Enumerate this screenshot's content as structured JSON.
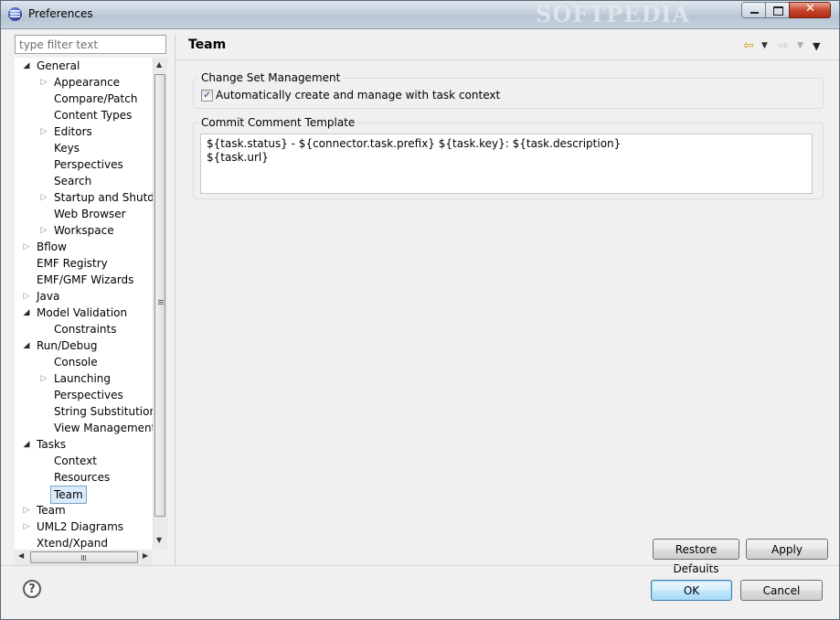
{
  "window": {
    "title": "Preferences",
    "watermark": "SOFTPEDIA",
    "minimize": "minimize",
    "maximize": "maximize",
    "close": "close"
  },
  "filter": {
    "placeholder": "type filter text"
  },
  "tree": [
    {
      "label": "General",
      "level": 0,
      "twisty": "open",
      "icon": "tree-twisty-open-icon"
    },
    {
      "label": "Appearance",
      "level": 1,
      "twisty": "closed",
      "icon": "tree-twisty-closed-icon"
    },
    {
      "label": "Compare/Patch",
      "level": 1,
      "twisty": "none"
    },
    {
      "label": "Content Types",
      "level": 1,
      "twisty": "none"
    },
    {
      "label": "Editors",
      "level": 1,
      "twisty": "closed",
      "icon": "tree-twisty-closed-icon"
    },
    {
      "label": "Keys",
      "level": 1,
      "twisty": "none"
    },
    {
      "label": "Perspectives",
      "level": 1,
      "twisty": "none"
    },
    {
      "label": "Search",
      "level": 1,
      "twisty": "none"
    },
    {
      "label": "Startup and Shutdov",
      "level": 1,
      "twisty": "closed",
      "icon": "tree-twisty-closed-icon"
    },
    {
      "label": "Web Browser",
      "level": 1,
      "twisty": "none"
    },
    {
      "label": "Workspace",
      "level": 1,
      "twisty": "closed",
      "icon": "tree-twisty-closed-icon"
    },
    {
      "label": "Bflow",
      "level": 0,
      "twisty": "closed",
      "icon": "tree-twisty-closed-icon"
    },
    {
      "label": "EMF Registry",
      "level": 0,
      "twisty": "none"
    },
    {
      "label": "EMF/GMF Wizards",
      "level": 0,
      "twisty": "none"
    },
    {
      "label": "Java",
      "level": 0,
      "twisty": "closed",
      "icon": "tree-twisty-closed-icon"
    },
    {
      "label": "Model Validation",
      "level": 0,
      "twisty": "open",
      "icon": "tree-twisty-open-icon"
    },
    {
      "label": "Constraints",
      "level": 1,
      "twisty": "none"
    },
    {
      "label": "Run/Debug",
      "level": 0,
      "twisty": "open",
      "icon": "tree-twisty-open-icon"
    },
    {
      "label": "Console",
      "level": 1,
      "twisty": "none"
    },
    {
      "label": "Launching",
      "level": 1,
      "twisty": "closed",
      "icon": "tree-twisty-closed-icon"
    },
    {
      "label": "Perspectives",
      "level": 1,
      "twisty": "none"
    },
    {
      "label": "String Substitution",
      "level": 1,
      "twisty": "none"
    },
    {
      "label": "View Management",
      "level": 1,
      "twisty": "none"
    },
    {
      "label": "Tasks",
      "level": 0,
      "twisty": "open",
      "icon": "tree-twisty-open-icon"
    },
    {
      "label": "Context",
      "level": 1,
      "twisty": "none"
    },
    {
      "label": "Resources",
      "level": 1,
      "twisty": "none"
    },
    {
      "label": "Team",
      "level": 1,
      "twisty": "none",
      "selected": true
    },
    {
      "label": "Team",
      "level": 0,
      "twisty": "closed",
      "icon": "tree-twisty-closed-icon"
    },
    {
      "label": "UML2 Diagrams",
      "level": 0,
      "twisty": "closed",
      "icon": "tree-twisty-closed-icon"
    },
    {
      "label": "Xtend/Xpand",
      "level": 0,
      "twisty": "none"
    }
  ],
  "page": {
    "title": "Team",
    "nav": {
      "back_icon": "back-arrow-icon",
      "forward_icon": "forward-arrow-icon",
      "menu_icon": "view-menu-icon"
    },
    "change_set": {
      "group_label": "Change Set Management",
      "checkbox_label": "Automatically create and manage with task context",
      "checked": true
    },
    "commit_template": {
      "group_label": "Commit Comment Template",
      "value": "${task.status} - ${connector.task.prefix} ${task.key}: ${task.description}\n${task.url}"
    },
    "restore_defaults": "Restore Defaults",
    "apply": "Apply"
  },
  "dialog": {
    "ok": "OK",
    "cancel": "Cancel",
    "help_icon": "help-icon"
  }
}
